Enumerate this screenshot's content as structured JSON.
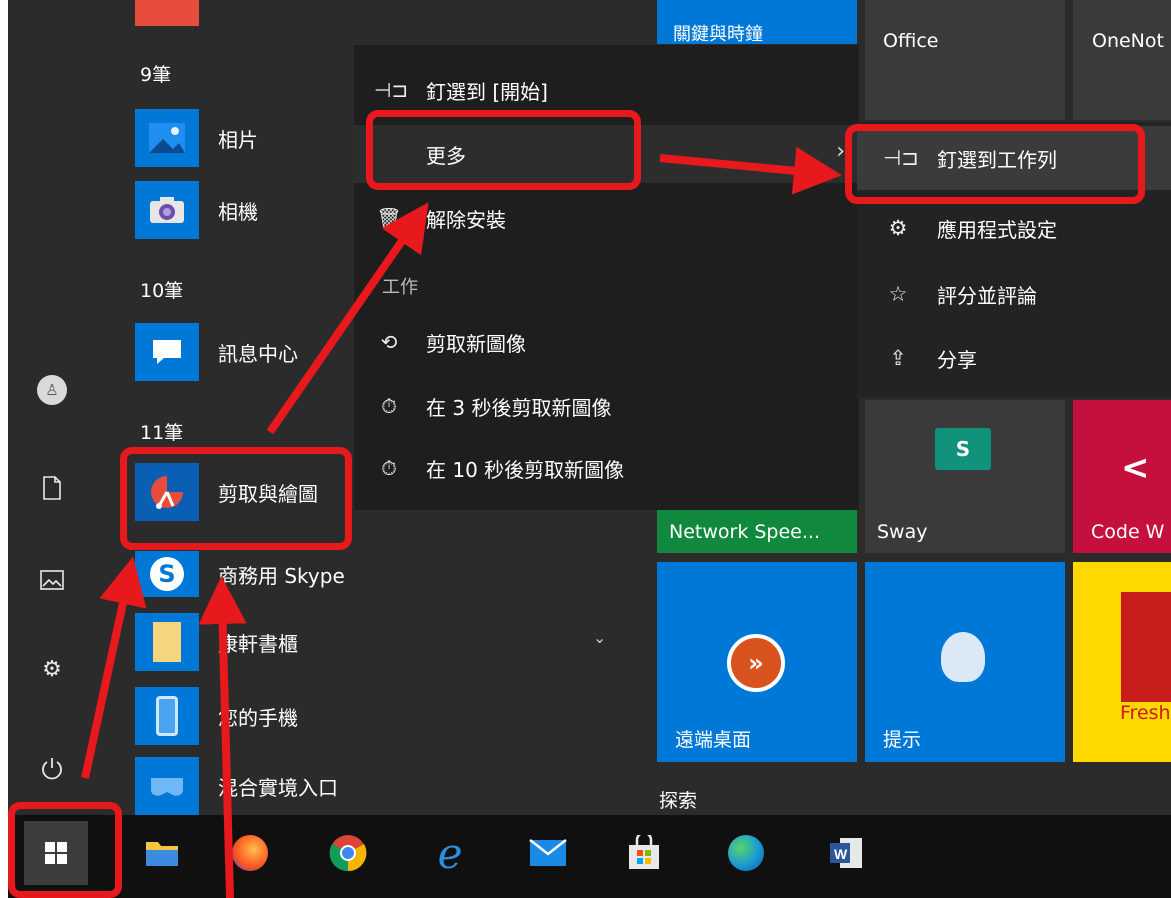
{
  "groups": {
    "g9": "9筆",
    "g10": "10筆",
    "g11": "11筆"
  },
  "apps": [
    {
      "label": "相片",
      "icon": "photos-icon"
    },
    {
      "label": "相機",
      "icon": "camera-icon"
    },
    {
      "label": "訊息中心",
      "icon": "message-center-icon"
    },
    {
      "label": "剪取與繪圖",
      "icon": "snip-sketch-icon"
    },
    {
      "label": "商務用 Skype",
      "icon": "skype-icon"
    },
    {
      "label": "康軒書櫃",
      "icon": "bookshelf-icon"
    },
    {
      "label": "您的手機",
      "icon": "your-phone-icon"
    },
    {
      "label": "混合實境入口",
      "icon": "mixed-reality-icon"
    }
  ],
  "context_menu": {
    "pin_start": "釘選到 [開始]",
    "more": "更多",
    "uninstall": "解除安裝",
    "section_tasks": "工作",
    "new_snip": "剪取新圖像",
    "snip_3s": "在 3 秒後剪取新圖像",
    "snip_10s": "在 10 秒後剪取新圖像"
  },
  "submenu": {
    "pin_taskbar": "釘選到工作列",
    "app_settings": "應用程式設定",
    "rate_review": "評分並評論",
    "share": "分享"
  },
  "tiles": {
    "top_blue": "關鍵與時鐘",
    "office": "Office",
    "onenote": "OneNot",
    "network_speed": "Network Spee...",
    "sway": "Sway",
    "code": "Code W",
    "remote_desktop": "遠端桌面",
    "tips": "提示",
    "fresh": "Fresh",
    "explore_header": "探索"
  },
  "taskbar": [
    "start-button",
    "file-explorer",
    "firefox",
    "chrome",
    "internet-explorer",
    "mail",
    "store",
    "edge",
    "word"
  ],
  "colors": {
    "accent_blue": "#0078d7",
    "annotation_red": "#e8191d",
    "menu_bg": "#1e1e1e",
    "network_green": "#10893e",
    "code_red": "#c50f3c",
    "fresh_yellow": "#ffd800"
  }
}
